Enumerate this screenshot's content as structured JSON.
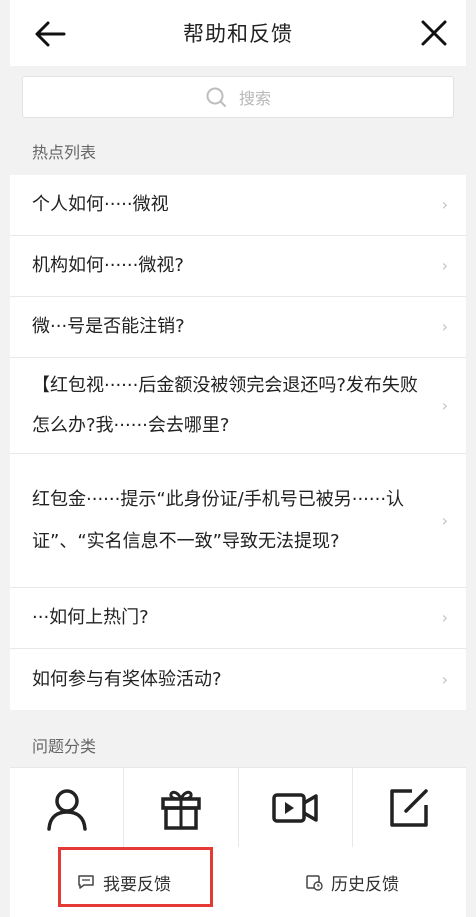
{
  "header": {
    "title": "帮助和反馈"
  },
  "search": {
    "placeholder": "搜索"
  },
  "hot": {
    "title": "热点列表",
    "items": [
      {
        "label": "个人如何·····微视"
      },
      {
        "label": "机构如何······微视?"
      },
      {
        "label": "微···号是否能注销?"
      },
      {
        "label": "【红包视······后金额没被领完会退还吗?发布失败怎么办?我······会去哪里?"
      },
      {
        "label": "红包金······提示“此身份证/手机号已被另······认证”、“实名信息不一致”导致无法提现?"
      },
      {
        "label": "···如何上热门?"
      },
      {
        "label": "如何参与有奖体验活动?"
      }
    ]
  },
  "categories": {
    "title": "问题分类",
    "items": [
      {
        "icon": "user-icon"
      },
      {
        "icon": "gift-icon"
      },
      {
        "icon": "video-camera-icon"
      },
      {
        "icon": "edit-icon"
      }
    ]
  },
  "bottom": {
    "feedback": "我要反馈",
    "history": "历史反馈"
  },
  "colors": {
    "highlight": "#e53935",
    "background": "#f2f2f2"
  }
}
